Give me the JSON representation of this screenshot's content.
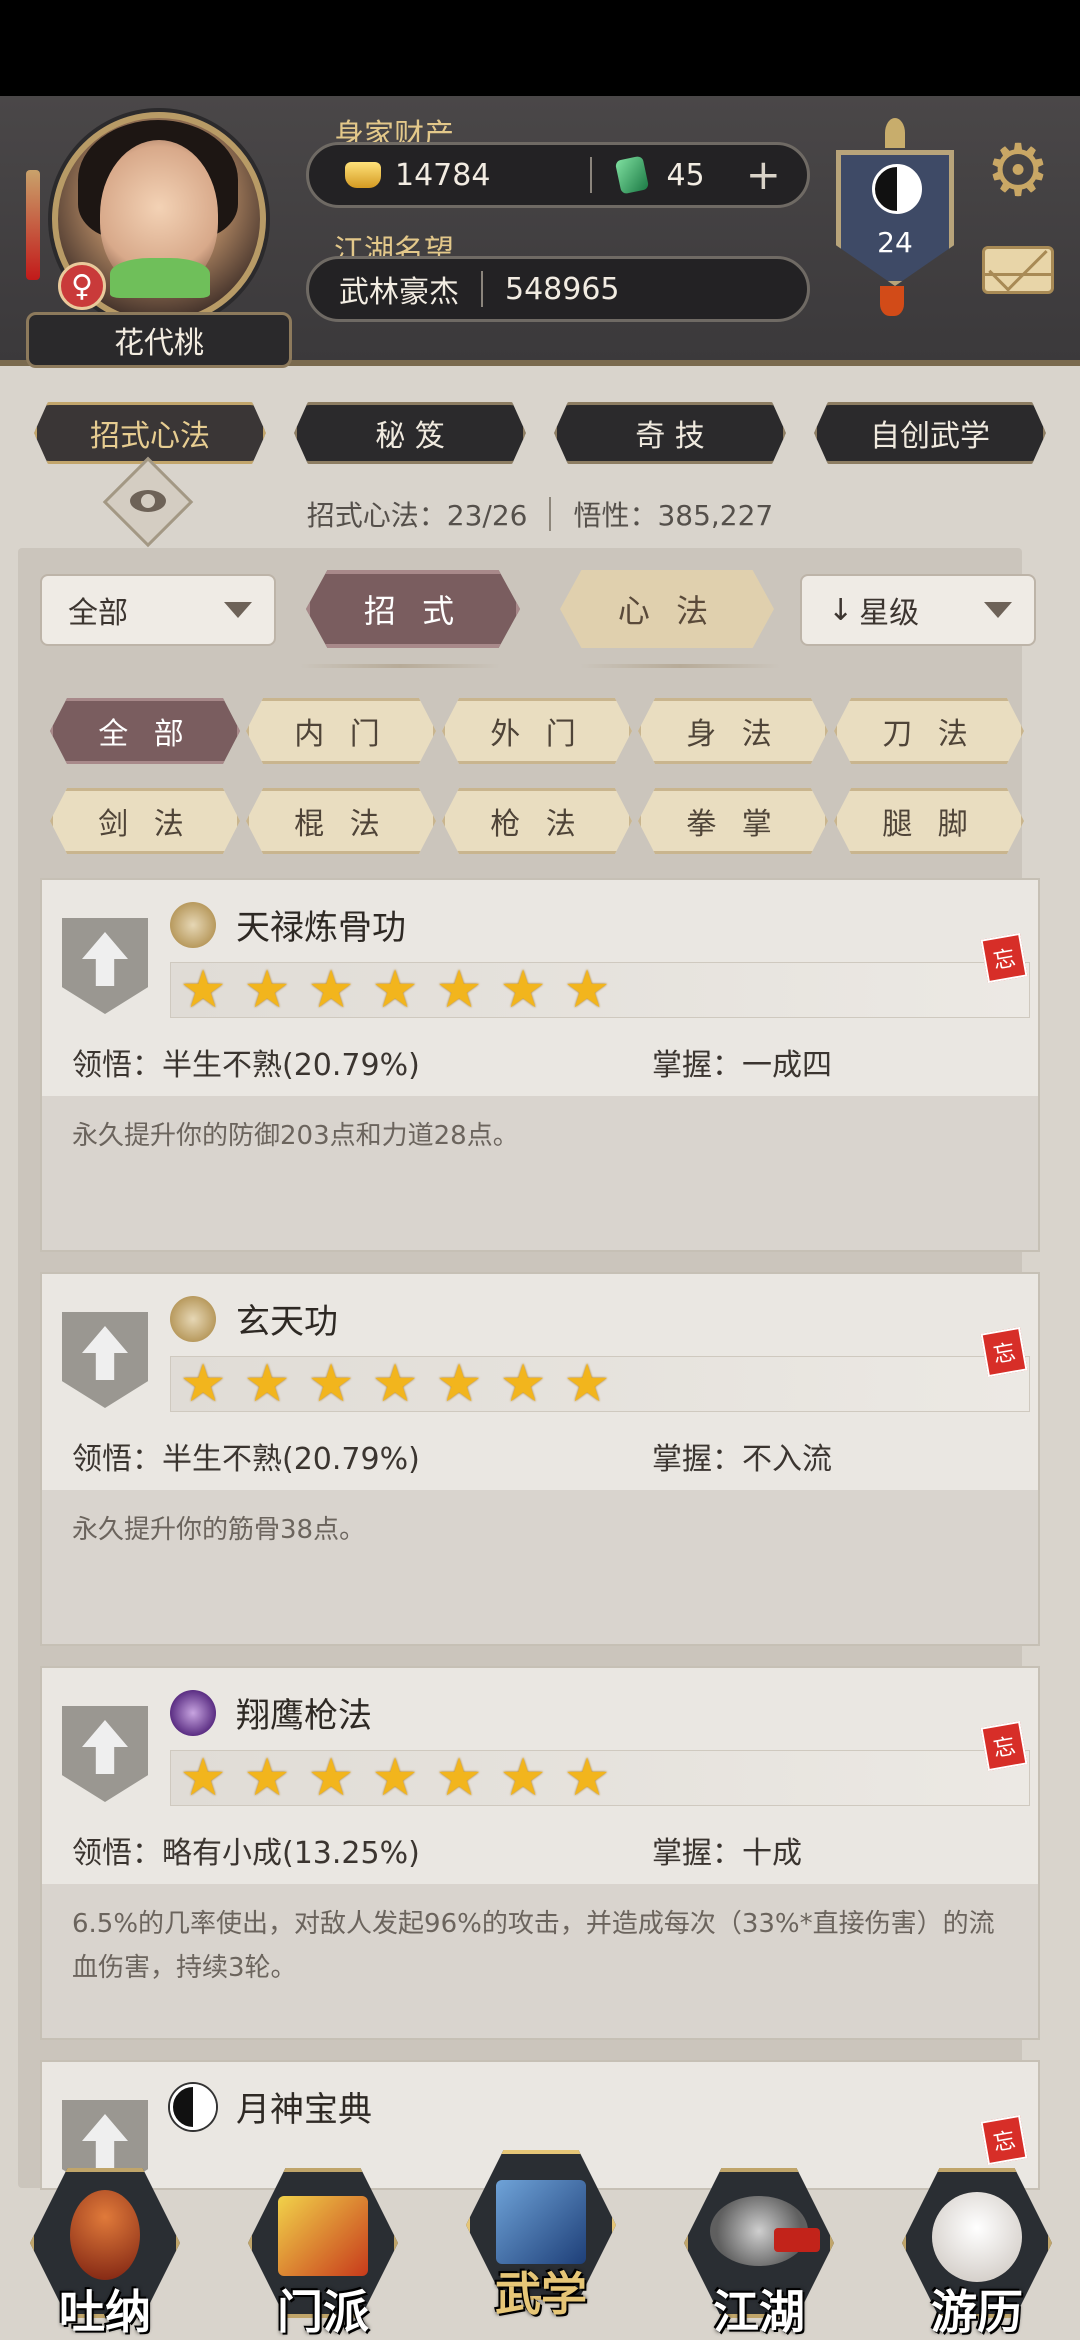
{
  "header": {
    "character_name": "花代桃",
    "wealth_label": "身家财产",
    "gold": "14784",
    "jade": "45",
    "plus": "+",
    "reputation_label": "江湖名望",
    "reputation_title": "武林豪杰",
    "reputation_value": "548965",
    "sect_level": "24"
  },
  "main_tabs": [
    "招式心法",
    "秘 笈",
    "奇 技",
    "自创武学"
  ],
  "stats": {
    "skills": "招式心法：23/26",
    "insight": "悟性：385,227"
  },
  "filters": {
    "category_dropdown": "全部",
    "type_active": "招 式",
    "type_other": "心 法",
    "sort_dropdown": "星级"
  },
  "chips": [
    "全 部",
    "内 门",
    "外 门",
    "身 法",
    "刀 法",
    "剑 法",
    "棍 法",
    "枪 法",
    "拳 掌",
    "腿 脚"
  ],
  "skills": [
    {
      "name": "天禄炼骨功",
      "icon": "goat-skull-icon",
      "stars": 7,
      "comprehension": "领悟：半生不熟(20.79%)",
      "mastery": "掌握：一成四",
      "description": "永久提升你的防御203点和力道28点。",
      "forget": "忘"
    },
    {
      "name": "玄天功",
      "icon": "goat-skull-icon",
      "stars": 7,
      "comprehension": "领悟：半生不熟(20.79%)",
      "mastery": "掌握：不入流",
      "description": "永久提升你的筋骨38点。",
      "forget": "忘"
    },
    {
      "name": "翔鹰枪法",
      "icon": "spear-icon",
      "stars": 7,
      "comprehension": "领悟：略有小成(13.25%)",
      "mastery": "掌握：十成",
      "description": "6.5%的几率使出，对敌人发起96%的攻击，并造成每次（33%*直接伤害）的流血伤害，持续3轮。",
      "forget": "忘"
    },
    {
      "name": "月神宝典",
      "icon": "yin-yang-icon",
      "forget": "忘"
    }
  ],
  "bottom_nav": [
    "吐纳",
    "门派",
    "武学",
    "江湖",
    "游历"
  ],
  "colors": {
    "accent": "#7a5d5f",
    "star": "#f2b51d",
    "gold_text": "#e3c88a"
  }
}
